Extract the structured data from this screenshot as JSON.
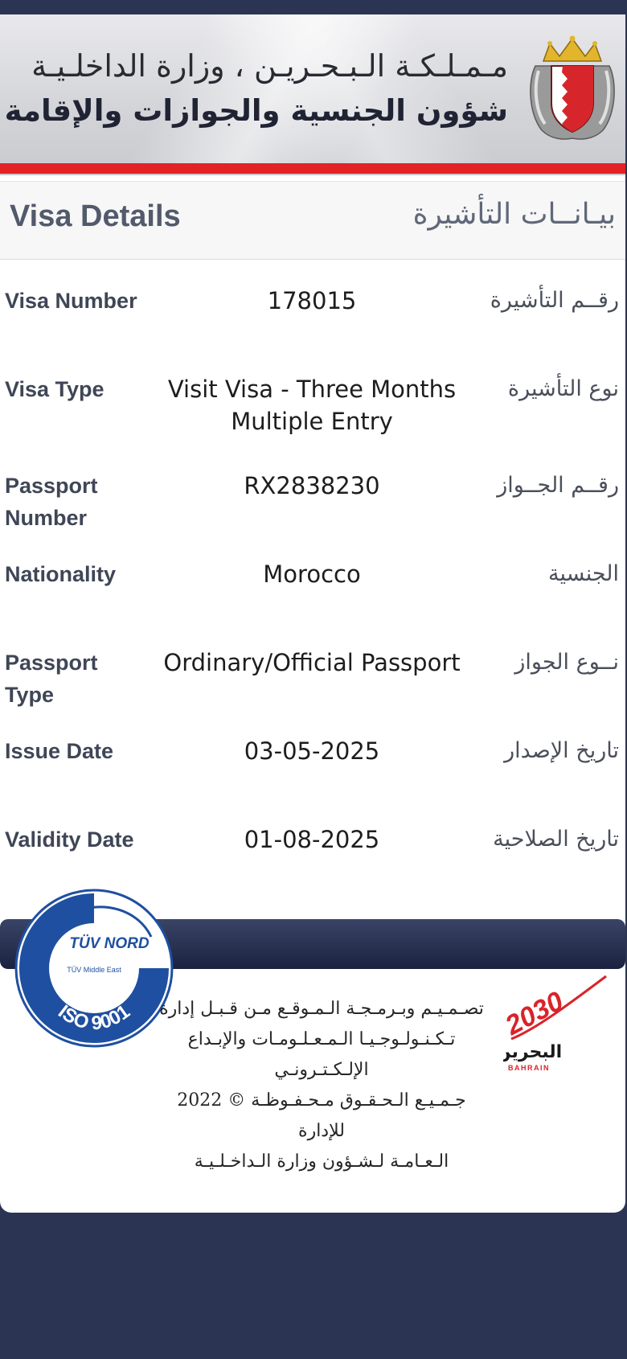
{
  "header": {
    "ministry": "مـمـلـكـة الـبـحـريـن ، وزارة الداخلـيـة",
    "department": "شؤون الجنسية والجوازات والإقامة"
  },
  "section": {
    "title_en": "Visa Details",
    "title_ar": "بيـانــات التأشيرة"
  },
  "rows": [
    {
      "label": "Visa Number",
      "value": "178015",
      "label_ar": "رقــم التأشيرة"
    },
    {
      "label": "Visa Type",
      "value": "Visit Visa - Three Months Multiple Entry",
      "label_ar": "نوع التأشيرة"
    },
    {
      "label": "Passport Number",
      "value": "RX2838230",
      "label_ar": "رقــم الجــواز"
    },
    {
      "label": "Nationality",
      "value": "Morocco",
      "label_ar": "الجنسية"
    },
    {
      "label": "Passport Type",
      "value": "Ordinary/Official Passport",
      "label_ar": "نــوع الجواز"
    },
    {
      "label": "Issue Date",
      "value": "03-05-2025",
      "label_ar": "تاريخ الإصدار"
    },
    {
      "label": "Validity Date",
      "value": "01-08-2025",
      "label_ar": "تاريخ الصلاحية"
    }
  ],
  "footer": {
    "tuv_brand": "TÜV NORD",
    "tuv_sub": "TÜV Middle East",
    "iso": "ISO 9001",
    "credits_line1": "تصـمـيـم وبـرمـجـة الـمـوقـع مـن قـبـل إدارة",
    "credits_line2": "تـكـنـولـوجـيـا الـمـعـلـومـات والإبـداع",
    "credits_line3": "الإلـكـتـرونـي",
    "copyright_line1": "جـمـيـع الـحـقـوق مـحـفـوظـة © 2022 للإدارة",
    "copyright_line2": "الـعـامـة لـشـؤون وزارة الـداخـلـيـة",
    "vision_year": "2030",
    "vision_ar": "البحرين",
    "vision_en": "BAHRAIN"
  },
  "colors": {
    "navy": "#2b3553",
    "red": "#e32226",
    "tuv_blue": "#1f4fa0",
    "vision_red": "#d9232a"
  }
}
